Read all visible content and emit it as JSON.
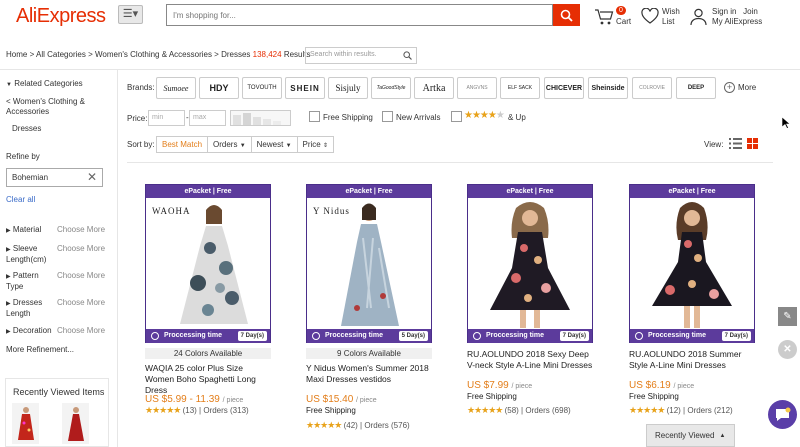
{
  "header": {
    "logo": "AliExpress",
    "search_placeholder": "I'm shopping for...",
    "cart_count": "0",
    "cart_label": "Cart",
    "wish_line1": "Wish",
    "wish_line2": "List",
    "signin": "Sign in",
    "join": "Join",
    "my_account": "My AliExpress"
  },
  "breadcrumb": {
    "home": "Home",
    "all": "All Categories",
    "cat": "Women's Clothing & Accessories",
    "sub": "Dresses",
    "count": "138,424",
    "results": "Results",
    "within_placeholder": "Search within results."
  },
  "sidebar": {
    "related_title": "Related Categories",
    "back_link": "< Women's Clothing & Accessories",
    "dresses": "Dresses",
    "refine_by": "Refine by",
    "refine_value": "Bohemian",
    "clear_all": "Clear all",
    "filters": [
      {
        "label": "Material",
        "more": "Choose More"
      },
      {
        "label": "Sleeve Length(cm)",
        "more": "Choose More"
      },
      {
        "label": "Pattern Type",
        "more": "Choose More"
      },
      {
        "label": "Dresses Length",
        "more": "Choose More"
      },
      {
        "label": "Decoration",
        "more": "Choose More"
      }
    ],
    "more_refinement": "More Refinement...",
    "recently_viewed": "Recently Viewed Items"
  },
  "filters": {
    "brands_label": "Brands:",
    "brands": [
      "Sumoee",
      "HDY",
      "TOVOUTH",
      "SHEIN",
      "Sisjuly",
      "TaGoodStyle",
      "Artka",
      "ANGVNS",
      "ELF SACK",
      "CHICEVER",
      "Sheinside",
      "COLROVIE",
      "DEEP"
    ],
    "more_label": "More",
    "price_label": "Price:",
    "min_placeholder": "min",
    "max_placeholder": "max",
    "free_shipping": "Free Shipping",
    "new_arrivals": "New Arrivals",
    "and_up": "& Up",
    "sort_label": "Sort by:",
    "sort_options": [
      "Best Match",
      "Orders",
      "Newest",
      "Price"
    ],
    "view_label": "View:"
  },
  "products": [
    {
      "badge": "ePacket | Free",
      "img_brand": "WAOHA",
      "proc_label": "Proccessing time",
      "days": "7 Day(s)",
      "colors": "24 Colors Available",
      "title": "WAQIA 25 color Plus Size Women Boho Spaghetti Long Dress",
      "price": "US $5.99 - 11.39",
      "per": "/ piece",
      "shipping": "",
      "reviews": "(13)",
      "orders": "Orders (313)"
    },
    {
      "badge": "ePacket | Free",
      "img_brand": "Y Nidus",
      "proc_label": "Proccessing time",
      "days": "5 Day(s)",
      "colors": "9 Colors Available",
      "title": "Y Nidus Women's Summer 2018 Maxi Dresses vestidos",
      "price": "US $15.40",
      "per": "/ piece",
      "shipping": "Free Shipping",
      "reviews": "(42)",
      "orders": "Orders (576)"
    },
    {
      "badge": "ePacket | Free",
      "img_brand": "",
      "proc_label": "Proccessing time",
      "days": "7 Day(s)",
      "colors": "",
      "title": "RU.AOLUNDO 2018 Sexy Deep V-neck Style A-Line Mini Dresses",
      "price": "US $7.99",
      "per": "/ piece",
      "shipping": "Free Shipping",
      "reviews": "(58)",
      "orders": "Orders (698)"
    },
    {
      "badge": "ePacket | Free",
      "img_brand": "",
      "proc_label": "Proccessing time",
      "days": "7 Day(s)",
      "colors": "",
      "title": "RU.AOLUNDO 2018 Summer Style A-Line Mini Dresses",
      "price": "US $6.19",
      "per": "/ piece",
      "shipping": "Free Shipping",
      "reviews": "(12)",
      "orders": "Orders (212)"
    }
  ],
  "footer": {
    "recently_viewed_tab": "Recently Viewed"
  },
  "colors": {
    "brand_red": "#e62e04",
    "price_orange": "#e37e1a",
    "badge_purple": "#5c3b9c"
  }
}
